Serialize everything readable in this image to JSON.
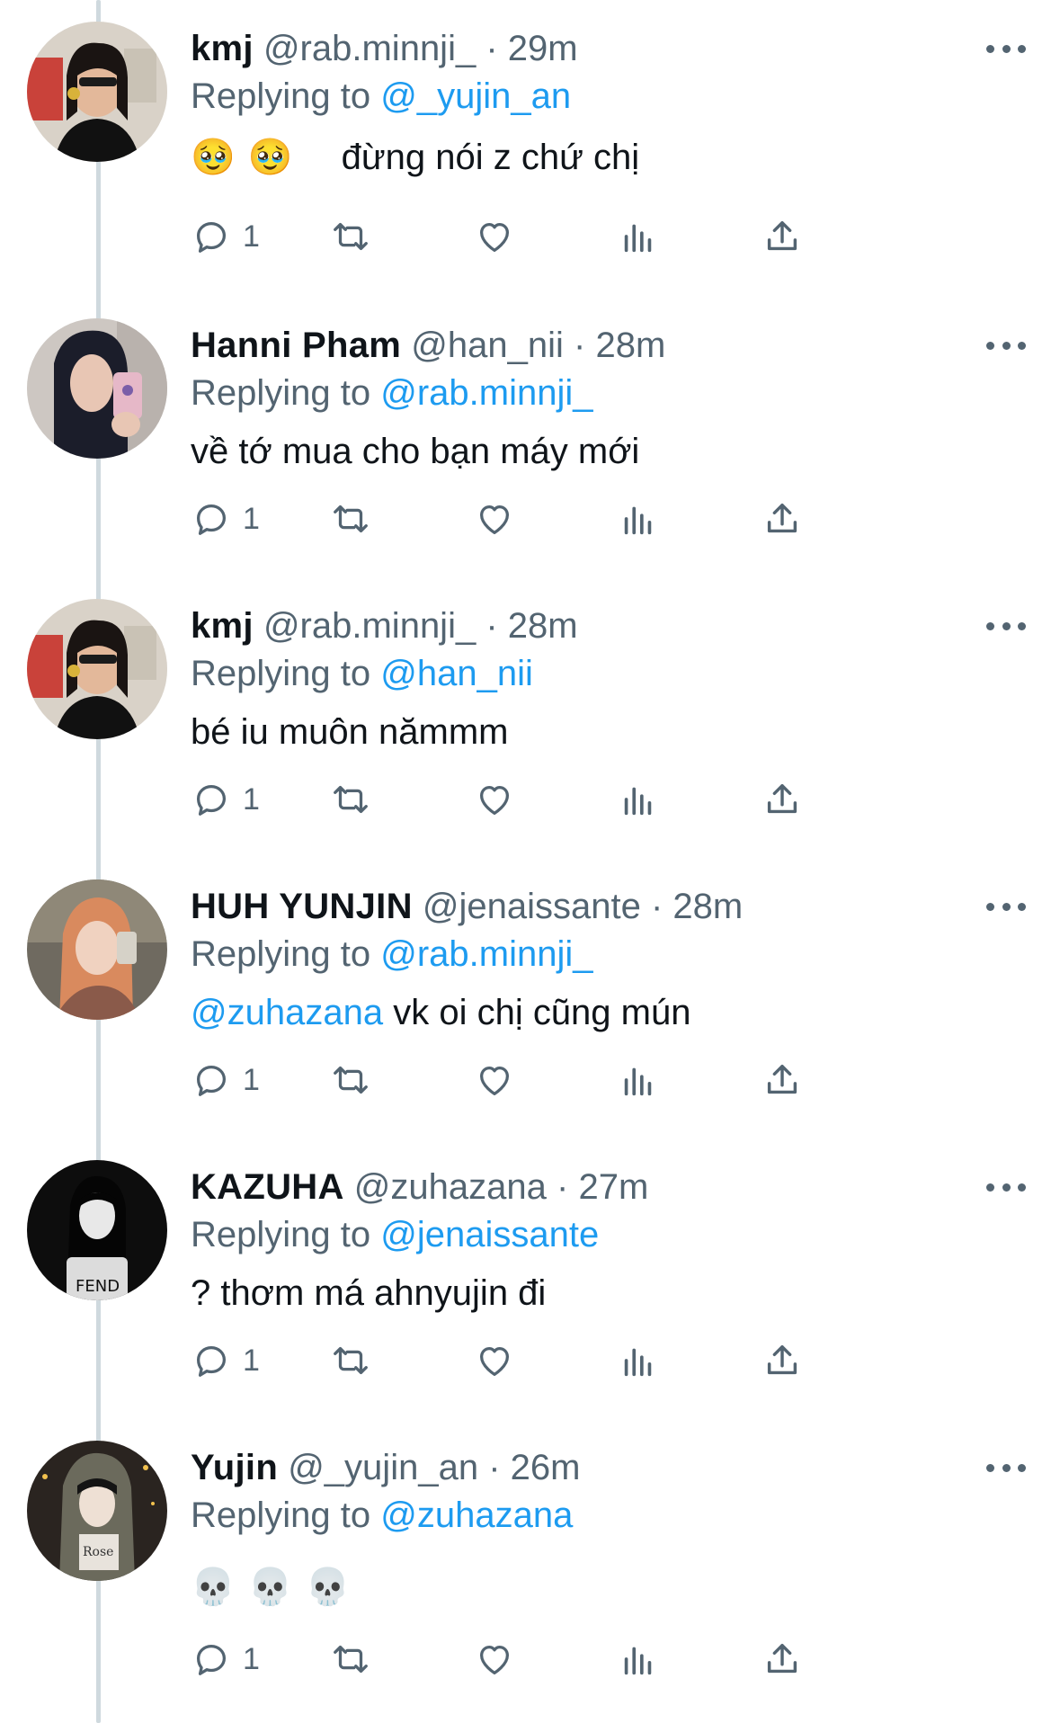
{
  "colors": {
    "link": "#1d9bf0",
    "secondary": "#536471",
    "primary": "#0f1419",
    "thread_line": "#cfd9de"
  },
  "tweets": [
    {
      "name": "kmj",
      "handle": "@rab.minnji_",
      "sep": "·",
      "time": "29m",
      "replying_label": "Replying to",
      "replying_to": "@_yujin_an",
      "body_emojis": [
        "🥹",
        "🥹"
      ],
      "body_text": "đừng nói z chứ chị",
      "reply_count": "1",
      "avatar": "kmj-avatar"
    },
    {
      "name": "Hanni Pham",
      "handle": "@han_nii",
      "sep": "·",
      "time": "28m",
      "replying_label": "Replying to",
      "replying_to": "@rab.minnji_",
      "body_text": "về tớ mua cho bạn máy mới",
      "reply_count": "1",
      "avatar": "hanni-avatar"
    },
    {
      "name": "kmj",
      "handle": "@rab.minnji_",
      "sep": "·",
      "time": "28m",
      "replying_label": "Replying to",
      "replying_to": "@han_nii",
      "body_text": "bé iu muôn nămmm",
      "reply_count": "1",
      "avatar": "kmj-avatar"
    },
    {
      "name": "HUH YUNJIN",
      "handle": "@jenaissante",
      "sep": "·",
      "time": "28m",
      "replying_label": "Replying to",
      "replying_to": "@rab.minnji_",
      "body_mention": "@zuhazana",
      "body_text": " vk oi chị cũng mún",
      "reply_count": "1",
      "avatar": "yunjin-avatar"
    },
    {
      "name": "KAZUHA",
      "handle": "@zuhazana",
      "sep": "·",
      "time": "27m",
      "replying_label": "Replying to",
      "replying_to": "@jenaissante",
      "body_text": "? thơm má ahnyujin đi",
      "reply_count": "1",
      "avatar": "kazuha-avatar"
    },
    {
      "name": "Yujin",
      "handle": "@_yujin_an",
      "sep": "·",
      "time": "26m",
      "replying_label": "Replying to",
      "replying_to": "@zuhazana",
      "body_emojis": [
        "💀",
        "💀",
        "💀"
      ],
      "body_text": "",
      "reply_count": "1",
      "avatar": "yujin-avatar"
    }
  ]
}
